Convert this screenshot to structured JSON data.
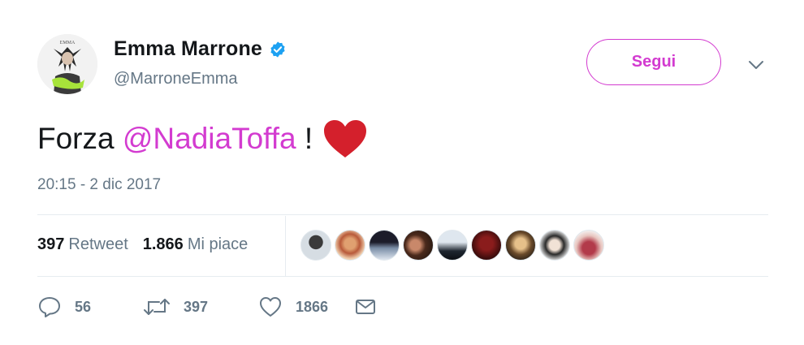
{
  "tweet": {
    "author": {
      "display_name": "Emma Marrone",
      "handle": "@MarroneEmma",
      "verified": true,
      "avatar_caption": "EMMA"
    },
    "follow_label": "Segui",
    "text_before": "Forza ",
    "mention": "@NadiaToffa",
    "text_after": " !",
    "emoji": "red-heart",
    "timestamp": "20:15 - 2 dic 2017",
    "stats": {
      "retweets_count": "397",
      "retweets_label": "Retweet",
      "likes_count": "1.866",
      "likes_label": "Mi piace"
    },
    "likers_count_shown": 9,
    "actions": {
      "reply_count": "56",
      "retweet_count": "397",
      "like_count": "1866"
    }
  },
  "icons": {
    "verified": "verified-badge-icon",
    "caret": "chevron-down-icon",
    "reply": "reply-icon",
    "retweet": "retweet-icon",
    "like": "heart-icon",
    "message": "envelope-icon"
  },
  "colors": {
    "accent": "#d33bd0",
    "verified": "#1da1f2",
    "muted": "#657786",
    "heart_emoji": "#d4202c"
  }
}
